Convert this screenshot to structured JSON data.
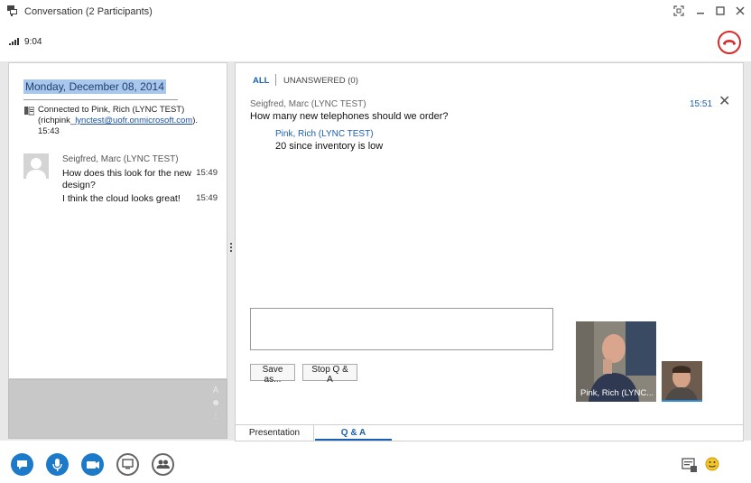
{
  "window": {
    "title": "Conversation (2 Participants)"
  },
  "status": {
    "duration": "9:04"
  },
  "chat": {
    "date_header": "Monday, December 08, 2014",
    "connection": {
      "prefix": "Connected to Pink, Rich (LYNC TEST)",
      "handle_open": "(richpink_",
      "email": "lynctest@uofr.onmicrosoft.com",
      "handle_close": ").",
      "time": "15:43"
    },
    "sender": "Seigfred, Marc (LYNC TEST)",
    "messages": [
      {
        "text": "How does this look for the new design?",
        "time": "15:49"
      },
      {
        "text": "I think the cloud looks great!",
        "time": "15:49"
      }
    ]
  },
  "qa": {
    "filter_all": "ALL",
    "filter_unanswered": "UNANSWERED (0)",
    "question": {
      "sender": "Seigfred, Marc (LYNC TEST)",
      "text": "How many new telephones should we order?",
      "time": "15:51"
    },
    "answer": {
      "sender": "Pink, Rich (LYNC TEST)",
      "text": "20 since inventory is low"
    },
    "input_value": "",
    "save_as_label": "Save as...",
    "stop_label": "Stop Q & A"
  },
  "video": {
    "participant_label": "Pink, Rich (LYNC..."
  },
  "stage_tabs": {
    "presentation": "Presentation",
    "qa": "Q & A"
  },
  "colors": {
    "accent": "#1a5fb4",
    "hangup": "#d92b2b",
    "toolbar_blue": "#1d7ac8",
    "date_highlight": "#a9c7ea"
  },
  "icons": {
    "titlebar": "conversation-icon",
    "hangup": "hang-up-phone-icon",
    "toolbar": [
      "im-icon",
      "mic-icon",
      "video-camera-icon",
      "present-icon",
      "participants-icon"
    ],
    "toolbar_right": [
      "conversation-options-icon",
      "emoticon-icon"
    ]
  }
}
